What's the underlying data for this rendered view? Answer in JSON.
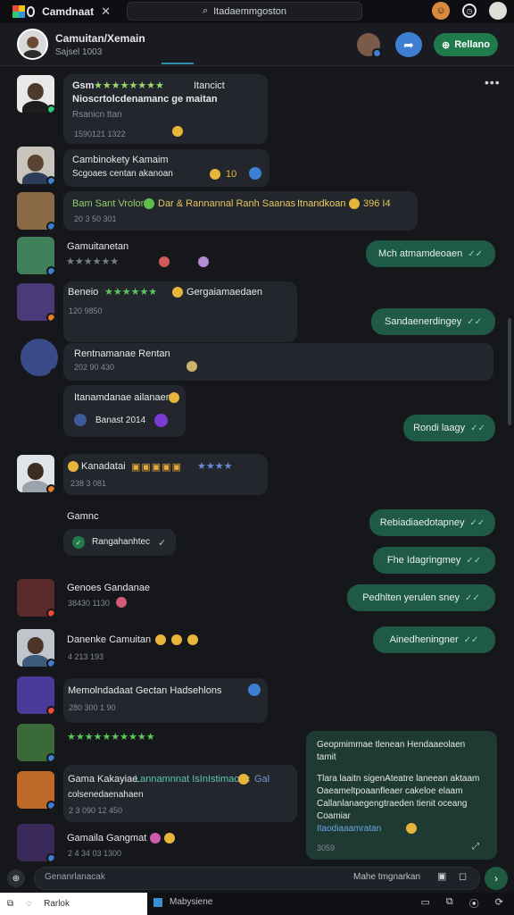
{
  "tab": {
    "title": "Camdnaat",
    "close": "✕"
  },
  "url": {
    "text": "Itadaemmgoston"
  },
  "header": {
    "title": "Camuitan/Xemain",
    "subtitle": "Sajsel 1003",
    "button_label": "Rellano"
  },
  "messages": [
    {
      "name": "Gsm",
      "stars": "★★★★★★★★",
      "extra": "Itancict",
      "text": "Nioscrtolcdenamanc ge maitan",
      "sub": "Rsanicn ttan",
      "time": "1590121 1322"
    },
    {
      "name": "Cambinokety Kamaim",
      "text": "Scgoaes centan akanoan",
      "nums": "10"
    },
    {
      "name": "Bam Sant Vrolor",
      "text": "Dar & Rannannal Ranh Saanas",
      "tail": "Itnandkoan",
      "nums": "396 I4",
      "time": "20 3 50 301"
    },
    {
      "name": "Gamuitanetan",
      "stars": "★★★★★★",
      "time": ""
    },
    {
      "name": "Beneio",
      "stars": "★★★★★★",
      "text": "Gergaiamaedaen",
      "time": "120 9850"
    },
    {
      "name": "Rentnamanae Rentan",
      "time": "202 90 430"
    },
    {
      "name": "Itanamdanae ailanaen",
      "sub": "Banast 2014"
    },
    {
      "name": "Kanadatai",
      "stars": "★★★★",
      "time": "238 3 081"
    },
    {
      "name": "Gamnc",
      "sub": "Rangahanhtec"
    },
    {
      "name": "Genoes Gandanae",
      "time": "38430 1130"
    },
    {
      "name": "Danenke Camuitan",
      "time": "4 213 193"
    },
    {
      "name": "Memolndadaat Gectan Hadsehlons",
      "time": "280 300 1 90"
    },
    {
      "stars": "★★★★★★★★★★"
    },
    {
      "name": "Gama Kakayiae",
      "text": "Lannamnnat IsInIstimaohc",
      "extra": "Gal",
      "sub": "colsenedaenahaen",
      "time": "2 3 090 12 450"
    },
    {
      "name": "Gamaila Gangmat",
      "time": "2 4 34 03 1300"
    }
  ],
  "outgoing": [
    {
      "text": "Mch atmamdeoaen",
      "tick": "✓✓"
    },
    {
      "text": "Sandaenerdingey",
      "tick": "✓✓"
    },
    {
      "text": "Rondi laagy",
      "tick": "✓✓"
    },
    {
      "text": "Rebiadiaedotapney",
      "tick": "✓✓"
    },
    {
      "text": "Fhe Idagringmey",
      "tick": "✓✓"
    },
    {
      "text": "Pedhlten yerulen sney",
      "tick": "✓✓"
    },
    {
      "text": "Ainedheningner",
      "tick": "✓✓"
    }
  ],
  "long_out": {
    "title": "Geopmimmae tlenean Hendaaeolaen",
    "title2": "tamit",
    "body1": "Tlara laaitn sigenAteatre laneean aktaam",
    "body2": "Oaeameltpoaanfleaer cakeloe elaam",
    "body3": "Callanlanaegengtraeden tienit oceang",
    "body4": "Coamiar",
    "link": "Itaodiaaamratan",
    "time": "3059"
  },
  "composer": {
    "placeholder": "Genanrlanacak",
    "right_text": "Mahe tmgnarkan"
  },
  "taskbar": {
    "active": "Rarlok",
    "second": "Mabysiene"
  }
}
